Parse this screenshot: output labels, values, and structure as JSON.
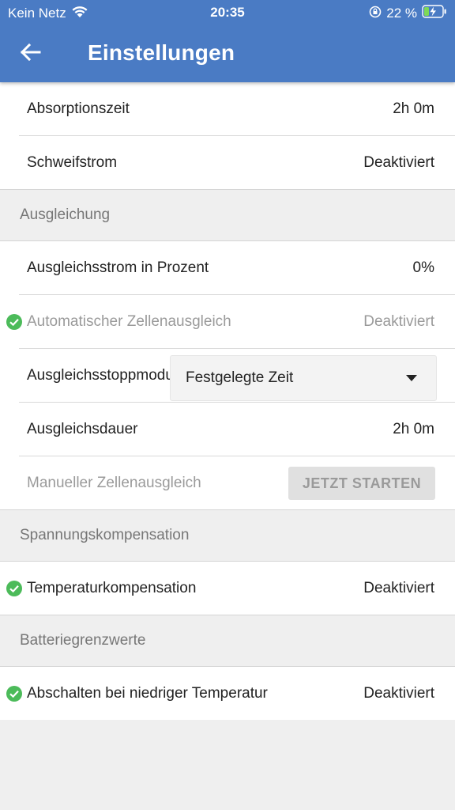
{
  "status_bar": {
    "carrier": "Kein Netz",
    "time": "20:35",
    "battery_percent": "22 %",
    "icons": [
      "wifi-icon",
      "rotation-lock-icon",
      "battery-charging-icon"
    ]
  },
  "toolbar": {
    "title": "Einstellungen",
    "back_icon": "arrow-left-icon"
  },
  "rows_top": [
    {
      "label": "Absorptionszeit",
      "value": "2h 0m"
    },
    {
      "label": "Schweifstrom",
      "value": "Deaktiviert"
    }
  ],
  "section_balancing": {
    "header": "Ausgleichung",
    "rows": [
      {
        "label": "Ausgleichsstrom in Prozent",
        "value": "0%"
      },
      {
        "label": "Automatischer Zellenausgleich",
        "value": "Deaktiviert",
        "disabled": true,
        "check_icon": "check-circle-icon"
      },
      {
        "label": "Ausgleichsstoppmodus",
        "dropdown_value": "Festgelegte Zeit",
        "dropdown_icon": "caret-down-icon"
      },
      {
        "label": "Ausgleichsdauer",
        "value": "2h 0m"
      },
      {
        "label": "Manueller Zellenausgleich",
        "button_label": "JETZT STARTEN",
        "disabled": true
      }
    ]
  },
  "section_voltage": {
    "header": "Spannungskompensation",
    "rows": [
      {
        "label": "Temperaturkompensation",
        "value": "Deaktiviert",
        "check_icon": "check-circle-icon"
      }
    ]
  },
  "section_limits": {
    "header": "Batteriegrenzwerte",
    "rows": [
      {
        "label": "Abschalten bei niedriger Temperatur",
        "value": "Deaktiviert",
        "check_icon": "check-circle-icon"
      }
    ]
  },
  "colors": {
    "app_bar": "#4a7bc4",
    "check_green": "#4cbb5a",
    "background": "#efefef"
  }
}
